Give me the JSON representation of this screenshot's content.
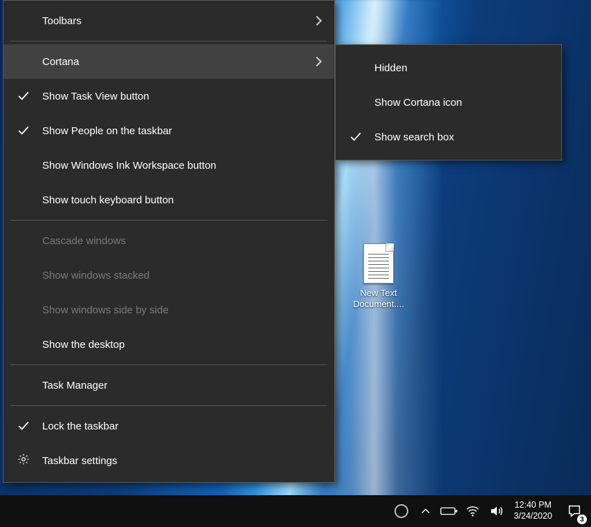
{
  "desktop": {
    "icon_label": "New Text Document...."
  },
  "menu": {
    "toolbars": "Toolbars",
    "cortana": "Cortana",
    "show_task_view": "Show Task View button",
    "show_people": "Show People on the taskbar",
    "show_ink": "Show Windows Ink Workspace button",
    "show_touch_keyboard": "Show touch keyboard button",
    "cascade": "Cascade windows",
    "stacked": "Show windows stacked",
    "side_by_side": "Show windows side by side",
    "show_desktop": "Show the desktop",
    "task_manager": "Task Manager",
    "lock_taskbar": "Lock the taskbar",
    "taskbar_settings": "Taskbar settings"
  },
  "submenu": {
    "hidden": "Hidden",
    "show_icon": "Show Cortana icon",
    "show_search_box": "Show search box"
  },
  "tray": {
    "time": "12:40 PM",
    "date": "3/24/2020",
    "action_center_count": "3"
  }
}
